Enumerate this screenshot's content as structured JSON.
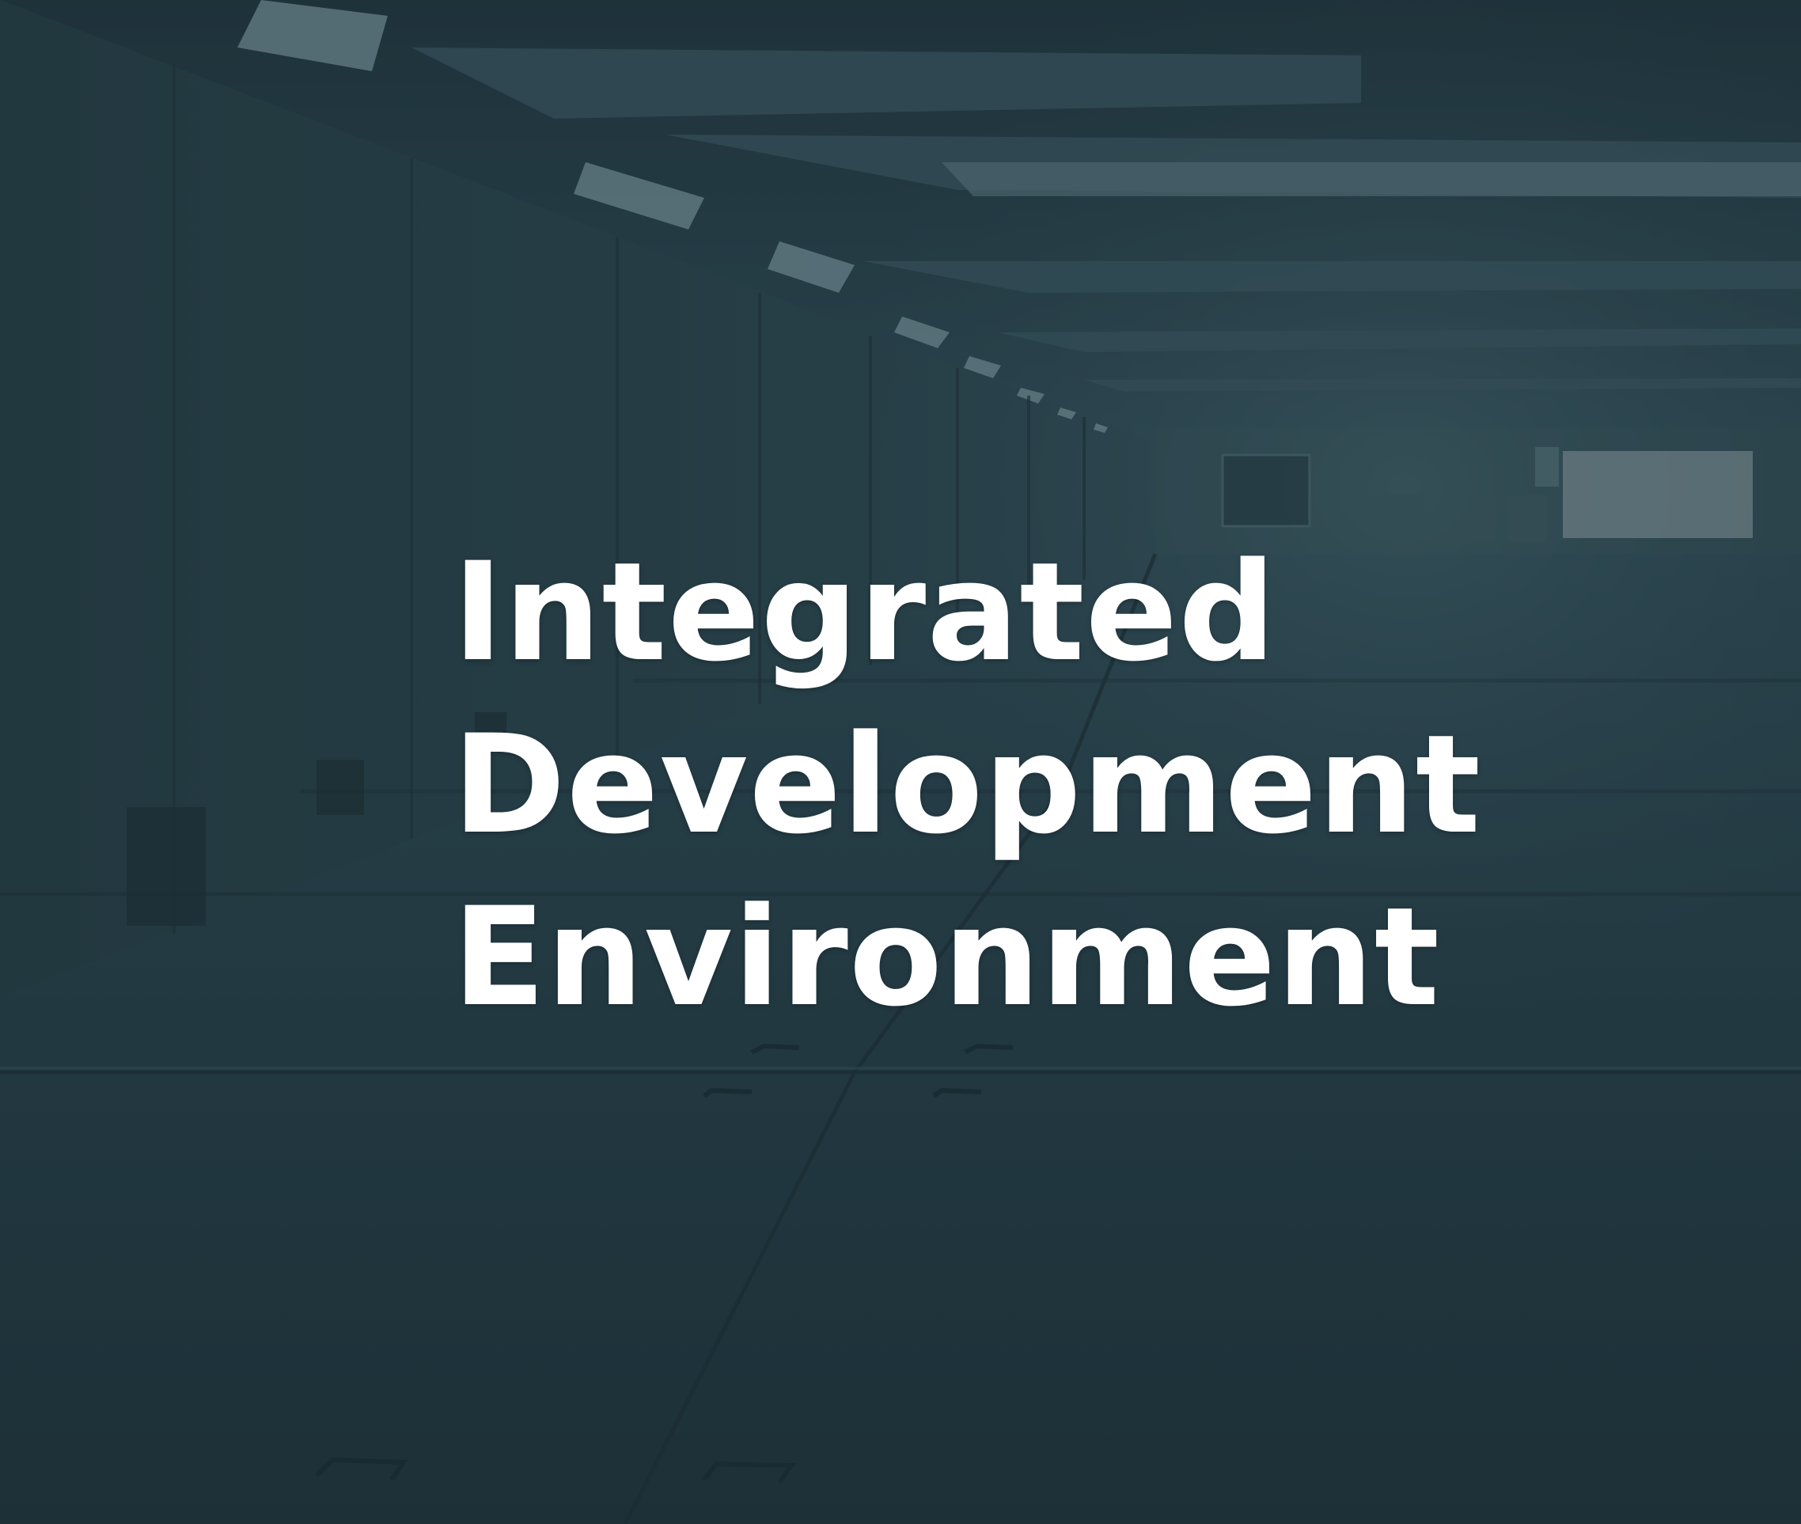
{
  "hero": {
    "title_lines": [
      "Integrated",
      "Development",
      "Environment"
    ]
  },
  "colors": {
    "overlay": "#22373f",
    "title_text": "#ffffff"
  }
}
